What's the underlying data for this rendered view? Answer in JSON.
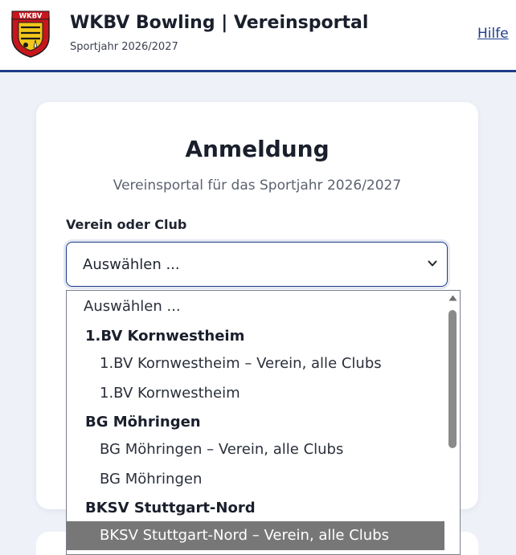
{
  "header": {
    "title": "WKBV Bowling | Vereinsportal",
    "subtitle": "Sportjahr 2026/2027",
    "help_link": "Hilfe",
    "logo_text": "WKBV",
    "brand_color": "#1e3c8c"
  },
  "login": {
    "title": "Anmeldung",
    "subtitle": "Vereinsportal für das Sportjahr 2026/2027",
    "club_label": "Verein oder Club",
    "select_value": "Auswählen ..."
  },
  "dropdown": {
    "options": [
      {
        "label": "Auswählen ...",
        "kind": "option"
      },
      {
        "label": "1.BV Kornwestheim",
        "kind": "group"
      },
      {
        "label": "1.BV Kornwestheim – Verein, alle Clubs",
        "kind": "option"
      },
      {
        "label": "1.BV Kornwestheim",
        "kind": "option"
      },
      {
        "label": "BG Möhringen",
        "kind": "group"
      },
      {
        "label": "BG Möhringen – Verein, alle Clubs",
        "kind": "option"
      },
      {
        "label": "BG Möhringen",
        "kind": "option"
      },
      {
        "label": "BKSV Stuttgart-Nord",
        "kind": "group"
      },
      {
        "label": "BKSV Stuttgart-Nord – Verein, alle Clubs",
        "kind": "option",
        "highlighted": true
      }
    ],
    "highlight_color": "#777777"
  }
}
